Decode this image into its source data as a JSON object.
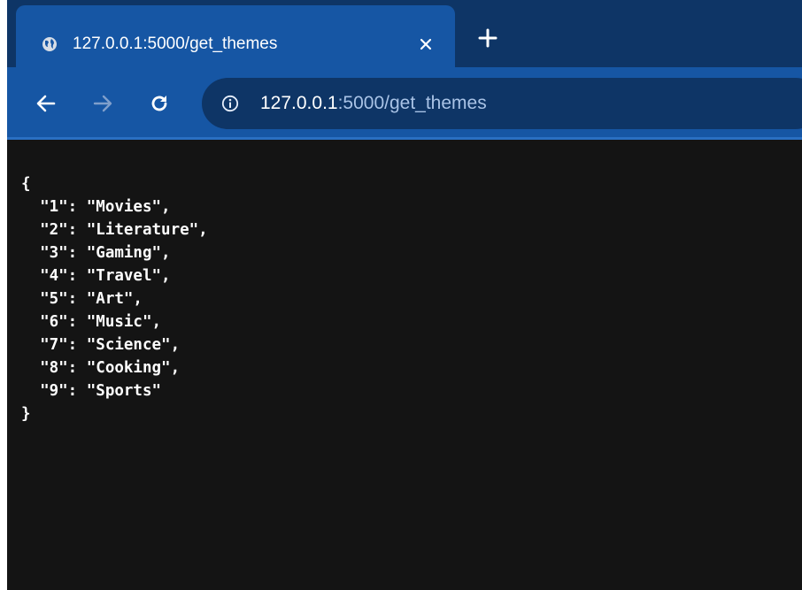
{
  "browser": {
    "tab": {
      "title": "127.0.0.1:5000/get_themes",
      "favicon": "globe-icon",
      "close_icon": "close-icon"
    },
    "new_tab_icon": "plus-icon",
    "nav": {
      "back_icon": "arrow-left-icon",
      "forward_icon": "arrow-right-icon",
      "reload_icon": "reload-icon"
    },
    "address_bar": {
      "info_icon": "info-icon",
      "url_host": "127.0.0.1",
      "url_rest": ":5000/get_themes"
    },
    "colors": {
      "tabstrip": "#0e3566",
      "active_tab": "#1656a4",
      "content_bg": "#141414"
    }
  },
  "json_view": {
    "open_brace": "{",
    "close_brace": "}",
    "lines": [
      "  \"1\": \"Movies\",",
      "  \"2\": \"Literature\",",
      "  \"3\": \"Gaming\",",
      "  \"4\": \"Travel\",",
      "  \"5\": \"Art\",",
      "  \"6\": \"Music\",",
      "  \"7\": \"Science\",",
      "  \"8\": \"Cooking\",",
      "  \"9\": \"Sports\""
    ]
  }
}
